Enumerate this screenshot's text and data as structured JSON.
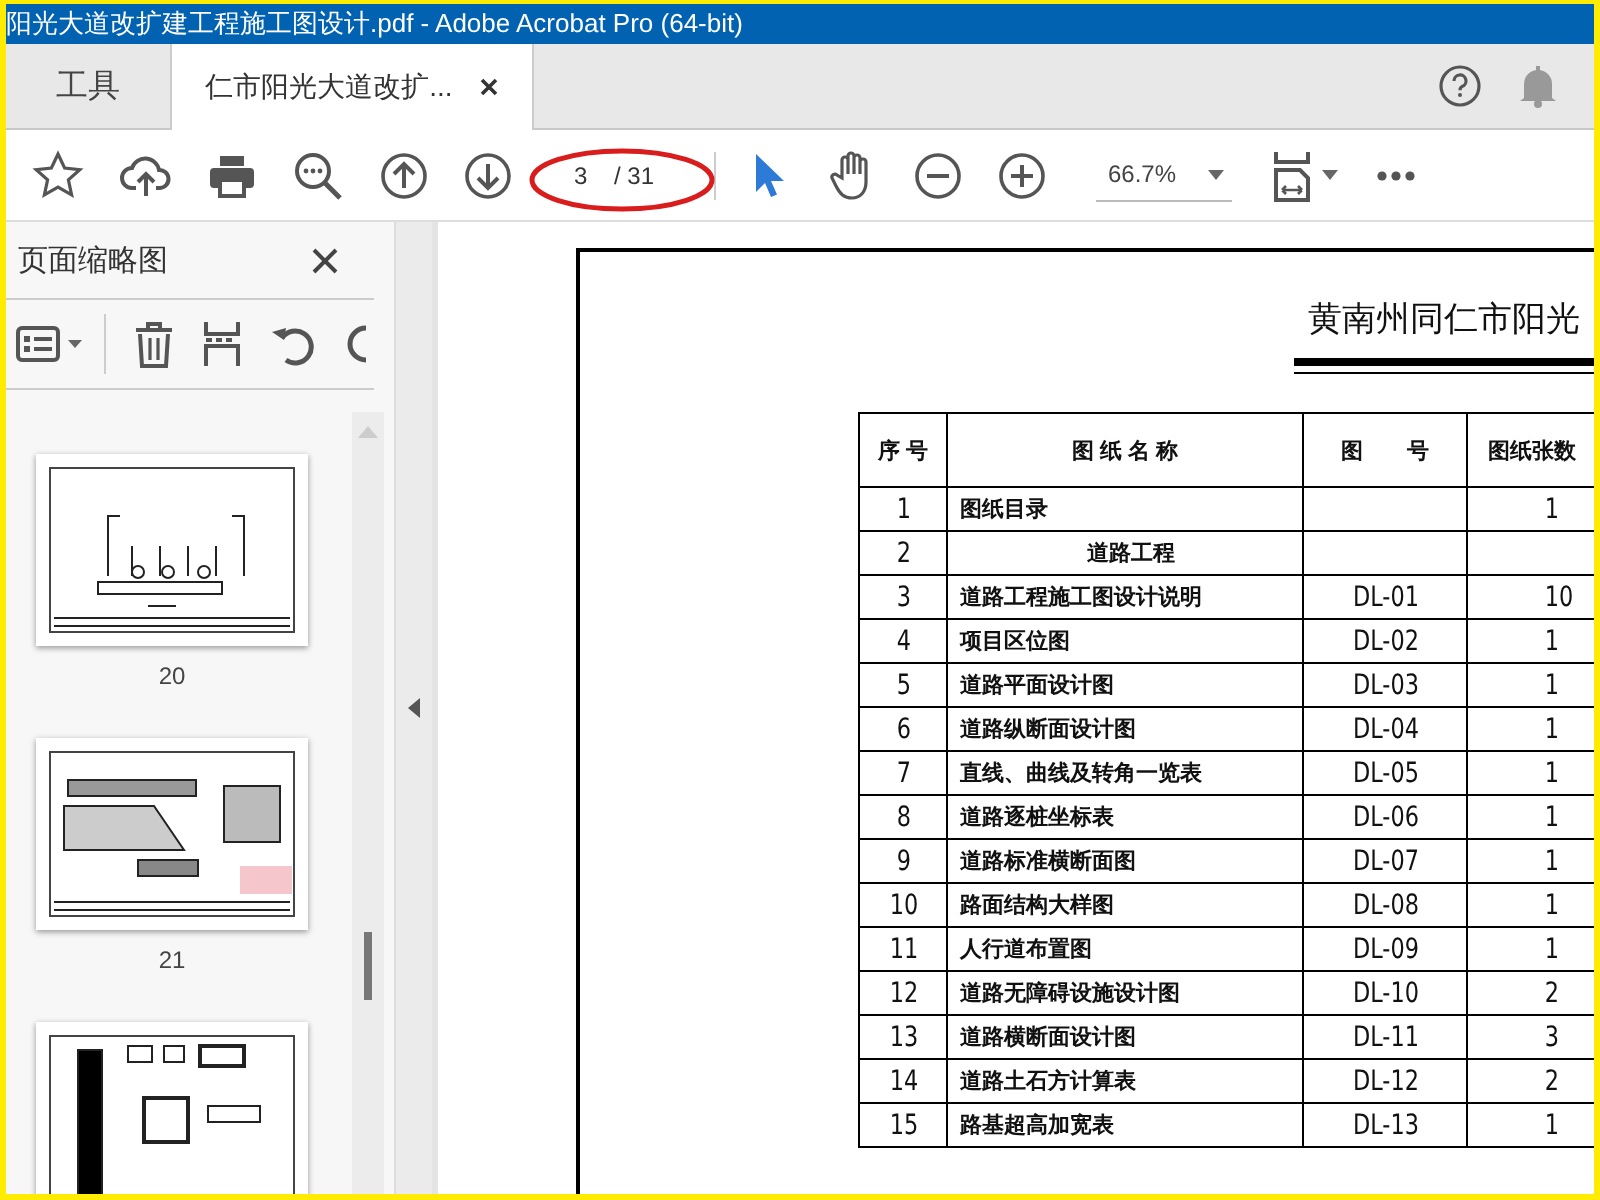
{
  "window": {
    "title": "阳光大道改扩建工程施工图设计.pdf - Adobe Acrobat Pro (64-bit)"
  },
  "tabs": [
    {
      "label": "工具",
      "selected": false
    },
    {
      "label": "仁市阳光大道改扩...",
      "selected": true
    }
  ],
  "toolbar": {
    "page_number": "3",
    "page_count": "/ 31",
    "zoom": "66.7%",
    "tools": [
      {
        "kind": "select",
        "selected": true
      },
      {
        "kind": "hand",
        "selected": false
      }
    ]
  },
  "sidebar": {
    "title": "页面缩略图",
    "thumbnails": [
      {
        "label": "20",
        "selected": false
      },
      {
        "label": "21",
        "selected": false
      },
      {
        "selected": false
      }
    ]
  },
  "document": {
    "title": "黄南州同仁市阳光",
    "table": {
      "columns": [
        "序 号",
        "图 纸 名 称",
        "图　　号",
        "图纸张数"
      ],
      "rows": [
        {
          "kind": "item",
          "no": "1",
          "name": "图纸目录",
          "count": "1"
        },
        {
          "kind": "section",
          "no": "2",
          "name": "道路工程"
        },
        {
          "kind": "item",
          "no": "3",
          "name": "道路工程施工图设计说明",
          "code": "DL-01",
          "count": "10"
        },
        {
          "kind": "item",
          "no": "4",
          "name": "项目区位图",
          "code": "DL-02",
          "count": "1"
        },
        {
          "kind": "item",
          "no": "5",
          "name": "道路平面设计图",
          "code": "DL-03",
          "count": "1"
        },
        {
          "kind": "item",
          "no": "6",
          "name": "道路纵断面设计图",
          "code": "DL-04",
          "count": "1"
        },
        {
          "kind": "item",
          "no": "7",
          "name": "直线、曲线及转角一览表",
          "code": "DL-05",
          "count": "1"
        },
        {
          "kind": "item",
          "no": "8",
          "name": "道路逐桩坐标表",
          "code": "DL-06",
          "count": "1"
        },
        {
          "kind": "item",
          "no": "9",
          "name": "道路标准横断面图",
          "code": "DL-07",
          "count": "1"
        },
        {
          "kind": "item",
          "no": "10",
          "name": "路面结构大样图",
          "code": "DL-08",
          "count": "1"
        },
        {
          "kind": "item",
          "no": "11",
          "name": "人行道布置图",
          "code": "DL-09",
          "count": "1"
        },
        {
          "kind": "item",
          "no": "12",
          "name": "道路无障碍设施设计图",
          "code": "DL-10",
          "count": "2"
        },
        {
          "kind": "item",
          "no": "13",
          "name": "道路横断面设计图",
          "code": "DL-11",
          "count": "3"
        },
        {
          "kind": "item",
          "no": "14",
          "name": "道路土石方计算表",
          "code": "DL-12",
          "count": "2"
        },
        {
          "kind": "item",
          "no": "15",
          "name": "路基超高加宽表",
          "code": "DL-13",
          "count": "1"
        }
      ]
    }
  }
}
